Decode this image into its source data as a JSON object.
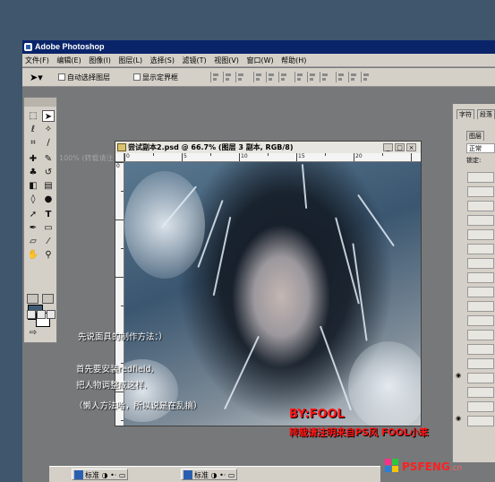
{
  "app": {
    "title": "Adobe Photoshop"
  },
  "menubar": {
    "items": [
      "文件(F)",
      "编辑(E)",
      "图像(I)",
      "图层(L)",
      "选择(S)",
      "滤镜(T)",
      "视图(V)",
      "窗口(W)",
      "帮助(H)"
    ]
  },
  "options": {
    "auto_select_layer": "自动选择图层",
    "show_bounding_box": "显示定界框"
  },
  "ghost_document": {
    "title": "100% (转载请注"
  },
  "document": {
    "title": "尝试副本2.psd @ 66.7% (图层 3 副本, RGB/8)",
    "ruler_h_labels": [
      "0",
      "5",
      "10",
      "15",
      "20"
    ],
    "ruler_v_labels": [
      "0"
    ]
  },
  "overlay": {
    "line1": "先说面具的制作方法：）",
    "line2": "首先要安装redfield,",
    "line3": "把人物调整成这样.",
    "line4": "（懒人方法哈，所以说是在乱搞）"
  },
  "credits": {
    "author": "BY:FOOL",
    "repost": "转载请注明来自PS风 FOOL小笨"
  },
  "panels": {
    "tabs": [
      "字符",
      "段落"
    ],
    "layers_tab": "图层",
    "blend_mode": "正常",
    "lock_label": "锁定:"
  },
  "taskbar": {
    "items": [
      {
        "label": "标准"
      },
      {
        "label": "标准"
      }
    ]
  },
  "logo": {
    "text": "PSFENG",
    "tld": ".cn",
    "colors": [
      "#ff2e8c",
      "#2ec63c",
      "#2a7fd6",
      "#f5c500"
    ]
  }
}
